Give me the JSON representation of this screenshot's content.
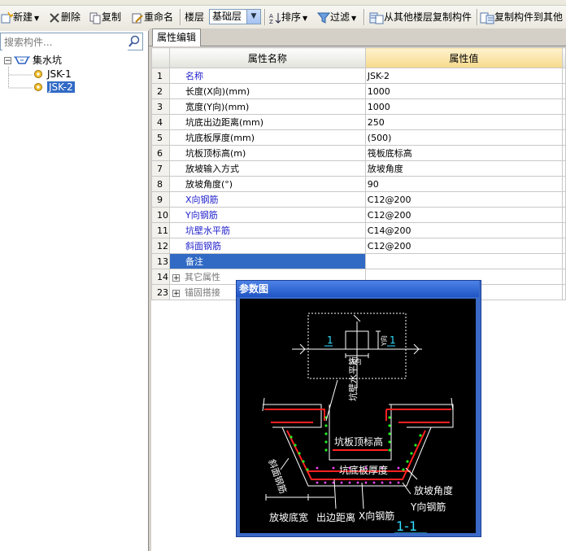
{
  "toolbar": {
    "new_label": "新建",
    "delete_label": "删除",
    "copy_label": "复制",
    "rename_label": "重命名",
    "floor_label": "楼层",
    "floor_value": "基础层",
    "sort_label": "排序",
    "filter_label": "过滤",
    "copy_from_floor_label": "从其他楼层复制构件",
    "copy_to_floor_label": "复制构件到其他"
  },
  "search": {
    "placeholder": "搜索构件..."
  },
  "tree": {
    "root_label": "集水坑",
    "children": [
      "JSK-1",
      "JSK-2"
    ],
    "selected": "JSK-2"
  },
  "tab": {
    "label": "属性编辑"
  },
  "grid": {
    "col_name": "属性名称",
    "col_value": "属性值",
    "rows": [
      {
        "num": "1",
        "name": "名称",
        "value": "JSK-2"
      },
      {
        "num": "2",
        "name": "长度(X向)(mm)",
        "value": "1000"
      },
      {
        "num": "3",
        "name": "宽度(Y向)(mm)",
        "value": "1000"
      },
      {
        "num": "4",
        "name": "坑底出边距离(mm)",
        "value": "250"
      },
      {
        "num": "5",
        "name": "坑底板厚度(mm)",
        "value": "(500)"
      },
      {
        "num": "6",
        "name": "坑板顶标高(m)",
        "value": "筏板底标高"
      },
      {
        "num": "7",
        "name": "放坡输入方式",
        "value": "放坡角度"
      },
      {
        "num": "8",
        "name": "放坡角度(°)",
        "value": "90"
      },
      {
        "num": "9",
        "name": "X向钢筋",
        "value": "C12@200"
      },
      {
        "num": "10",
        "name": "Y向钢筋",
        "value": "C12@200"
      },
      {
        "num": "11",
        "name": "坑壁水平筋",
        "value": "C14@200"
      },
      {
        "num": "12",
        "name": "斜面钢筋",
        "value": "C12@200"
      },
      {
        "num": "13",
        "name": "备注",
        "value": ""
      },
      {
        "num": "14",
        "name": "其它属性",
        "value": ""
      },
      {
        "num": "23",
        "name": "锚固搭接",
        "value": ""
      }
    ]
  },
  "param": {
    "title": "参数图",
    "labels": {
      "section_mark": "1",
      "x_dir": "X向",
      "y_dir": "Y向",
      "wall_rebar": "坑壁水平筋",
      "top_elev": "坑板顶标高",
      "slope_rebar": "斜面钢筋",
      "bottom_thick": "坑底板厚度",
      "slope_angle": "放坡角度",
      "y_rebar": "Y向钢筋",
      "x_rebar": "X向钢筋",
      "slope_width": "放坡底宽",
      "edge_dist": "出边距离",
      "section_name": "1-1"
    }
  },
  "colors": {
    "selection": "#316ac5",
    "header_value": "#f6d98b",
    "blue_text": "#2222cc"
  }
}
